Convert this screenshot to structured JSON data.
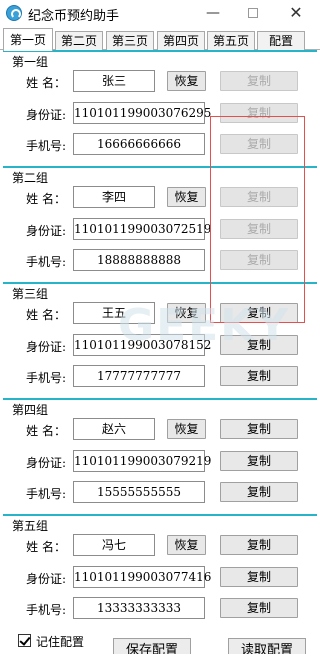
{
  "window": {
    "title": "纪念币预约助手",
    "minimize": "—",
    "close": "✕"
  },
  "tabs": [
    "第一页",
    "第二页",
    "第三页",
    "第四页",
    "第五页",
    "配置"
  ],
  "labels": {
    "name": "姓 名：",
    "id": "身份证:",
    "phone": "手机号:"
  },
  "buttons": {
    "restore": "恢复",
    "copy": "复制"
  },
  "groups": [
    {
      "title": "第一组",
      "name": "张三",
      "id": "110101199003076295",
      "phone": "16666666666",
      "copy_enabled": false
    },
    {
      "title": "第二组",
      "name": "李四",
      "id": "110101199003072519",
      "phone": "18888888888",
      "copy_enabled": false
    },
    {
      "title": "第三组",
      "name": "王五",
      "id": "110101199003078152",
      "phone": "17777777777",
      "copy_enabled": true
    },
    {
      "title": "第四组",
      "name": "赵六",
      "id": "110101199003079219",
      "phone": "15555555555",
      "copy_enabled": true
    },
    {
      "title": "第五组",
      "name": "冯七",
      "id": "110101199003077416",
      "phone": "13333333333",
      "copy_enabled": true
    }
  ],
  "bottom": {
    "remember_label": "记住配置",
    "remember_checked": true,
    "save_button": "保存配置",
    "load_button": "读取配置"
  },
  "watermark": "GEEKY",
  "colors": {
    "group_border": "#27b4c8",
    "highlight_box": "#e25050"
  }
}
